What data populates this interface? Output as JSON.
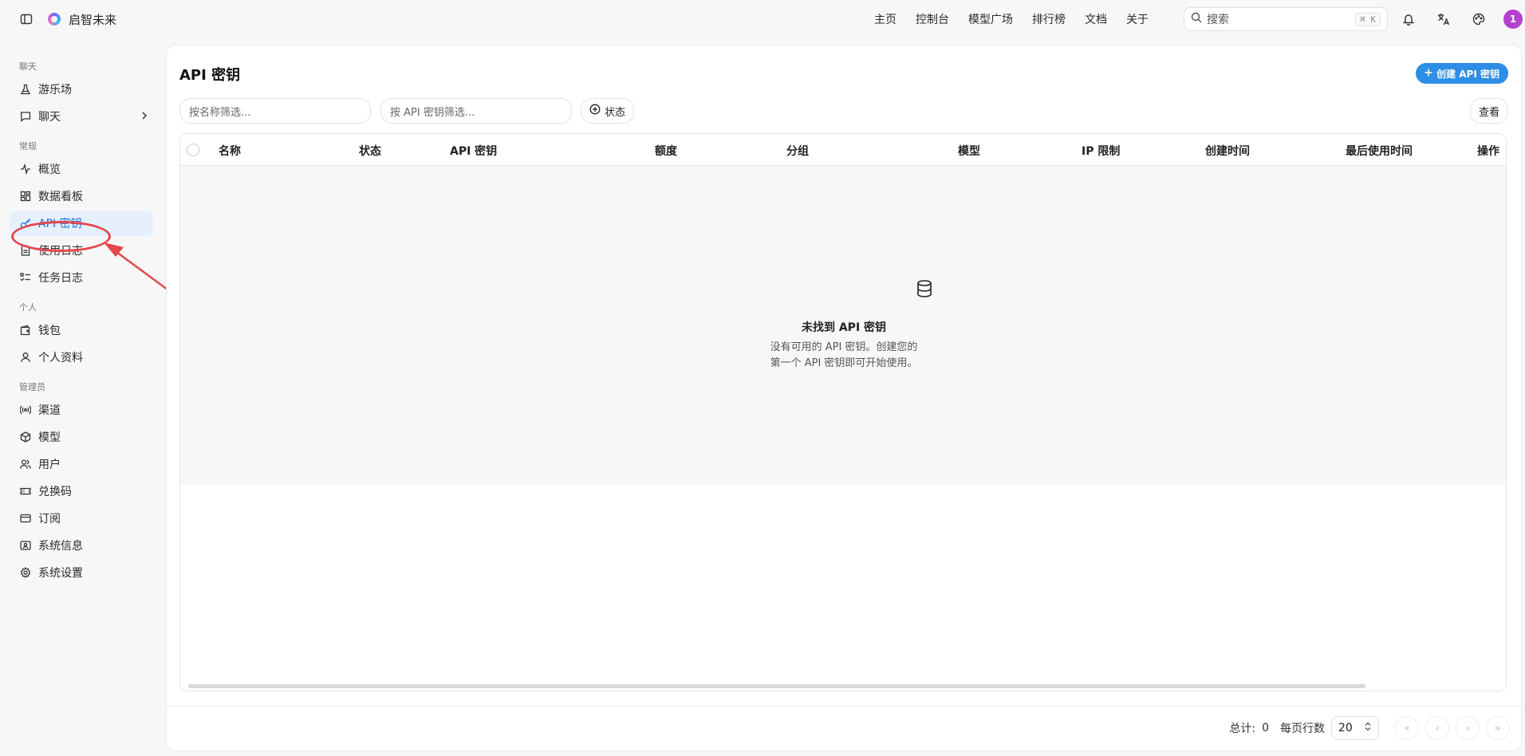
{
  "app": {
    "name": "启智未来"
  },
  "nav": [
    "主页",
    "控制台",
    "模型广场",
    "排行榜",
    "文档",
    "关于"
  ],
  "search": {
    "placeholder": "搜索",
    "shortcut": "⌘ K"
  },
  "user": {
    "avatar_label": "1"
  },
  "sidebar": {
    "groups": [
      {
        "label": "聊天",
        "items": [
          {
            "label": "游乐场",
            "icon": "flask-icon"
          },
          {
            "label": "聊天",
            "icon": "chat-icon"
          }
        ]
      },
      {
        "label": "常规",
        "items": [
          {
            "label": "概览",
            "icon": "activity-icon"
          },
          {
            "label": "数据看板",
            "icon": "dashboard-icon"
          },
          {
            "label": "API 密钥",
            "icon": "key-icon"
          },
          {
            "label": "使用日志",
            "icon": "file-icon"
          },
          {
            "label": "任务日志",
            "icon": "tasklist-icon"
          }
        ]
      },
      {
        "label": "个人",
        "items": [
          {
            "label": "钱包",
            "icon": "wallet-icon"
          },
          {
            "label": "个人资料",
            "icon": "user-icon"
          }
        ]
      },
      {
        "label": "管理员",
        "items": [
          {
            "label": "渠道",
            "icon": "radio-icon"
          },
          {
            "label": "模型",
            "icon": "box-icon"
          },
          {
            "label": "用户",
            "icon": "users-icon"
          },
          {
            "label": "兑换码",
            "icon": "ticket-icon"
          },
          {
            "label": "订阅",
            "icon": "card-icon"
          },
          {
            "label": "系统信息",
            "icon": "server-icon"
          },
          {
            "label": "系统设置",
            "icon": "gear-icon"
          }
        ]
      }
    ]
  },
  "page": {
    "title": "API 密钥",
    "create_button": "创建 API 密钥",
    "filter_name_placeholder": "按名称筛选...",
    "filter_key_placeholder": "按 API 密钥筛选...",
    "status_button": "状态",
    "view_button": "查看"
  },
  "table": {
    "columns": [
      "名称",
      "状态",
      "API 密钥",
      "额度",
      "分组",
      "模型",
      "IP 限制",
      "创建时间",
      "最后使用时间",
      "操作"
    ],
    "rows": []
  },
  "empty": {
    "title": "未找到 API 密钥",
    "desc_line1": "没有可用的 API 密钥。创建您的",
    "desc_line2": "第一个 API 密钥即可开始使用。"
  },
  "pagination": {
    "total_label": "总计:",
    "total": "0",
    "rows_label": "每页行数",
    "rows_per_page": "20"
  },
  "colors": {
    "accent": "#2e8de4",
    "active_bg": "#e6f0fd",
    "annotation": "#e4474b",
    "avatar": "#b53fd0"
  }
}
